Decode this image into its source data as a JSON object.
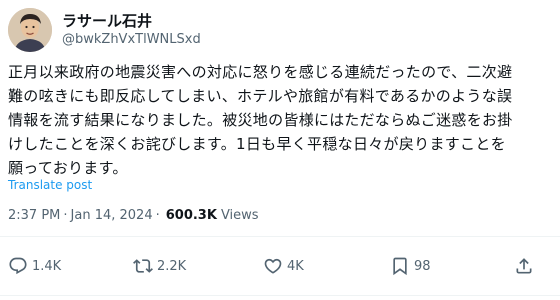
{
  "author": {
    "display_name": "ラサール石井",
    "handle": "@bwkZhVxTlWNLSxd"
  },
  "post": {
    "lines": [
      "正月以来政府の地震災害への対応に怒りを感じる連続だったので、二次避",
      "難の呟きにも即反応してしまい、ホテルや旅館が有料であるかのような誤",
      "情報を流す結果になりました。被災地の皆様にはただならぬご迷惑をお掛",
      "けしたことを深くお詫びします。1日も早く平穏な日々が戻りますことを",
      "願っております。"
    ],
    "translate_label": "Translate post"
  },
  "meta": {
    "time": "2:37 PM",
    "separator": "·",
    "date": "Jan 14, 2024",
    "views_count": "600.3K",
    "views_label": "Views"
  },
  "actions": {
    "reply_count": "1.4K",
    "retweet_count": "2.2K",
    "like_count": "4K",
    "bookmark_count": "98"
  },
  "icons": {
    "reply": "reply-icon",
    "retweet": "retweet-icon",
    "like": "heart-icon",
    "bookmark": "bookmark-icon",
    "share": "share-icon"
  },
  "colors": {
    "link": "#1d9bf0",
    "secondary_text": "#536471",
    "primary_text": "#0f1419"
  }
}
